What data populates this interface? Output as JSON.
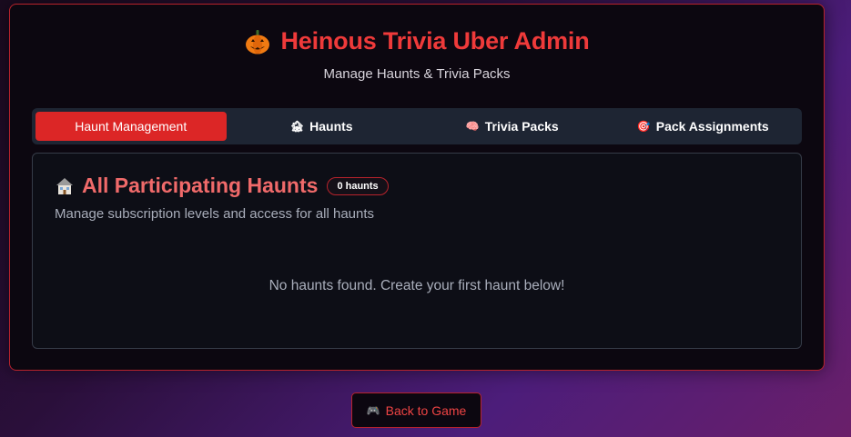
{
  "header": {
    "title": "Heinous Trivia Uber Admin",
    "subtitle": "Manage Haunts & Trivia Packs",
    "icon": "jack-o-lantern-icon"
  },
  "tabs": [
    {
      "label": "Haunt Management",
      "icon": "",
      "active": true
    },
    {
      "label": "Haunts",
      "icon": "🏚",
      "active": false
    },
    {
      "label": "Trivia Packs",
      "icon": "🧠",
      "active": false
    },
    {
      "label": "Pack Assignments",
      "icon": "🎯",
      "active": false
    }
  ],
  "section": {
    "title": "All Participating Haunts",
    "icon": "haunted-house-icon",
    "badge": "0 haunts",
    "description": "Manage subscription levels and access for all haunts",
    "empty_message": "No haunts found. Create your first haunt below!"
  },
  "footer": {
    "back_label": "Back to Game",
    "back_icon": "🎮"
  },
  "colors": {
    "accent": "#dc2626",
    "title": "#ef3a3a",
    "border": "#b8232c"
  }
}
